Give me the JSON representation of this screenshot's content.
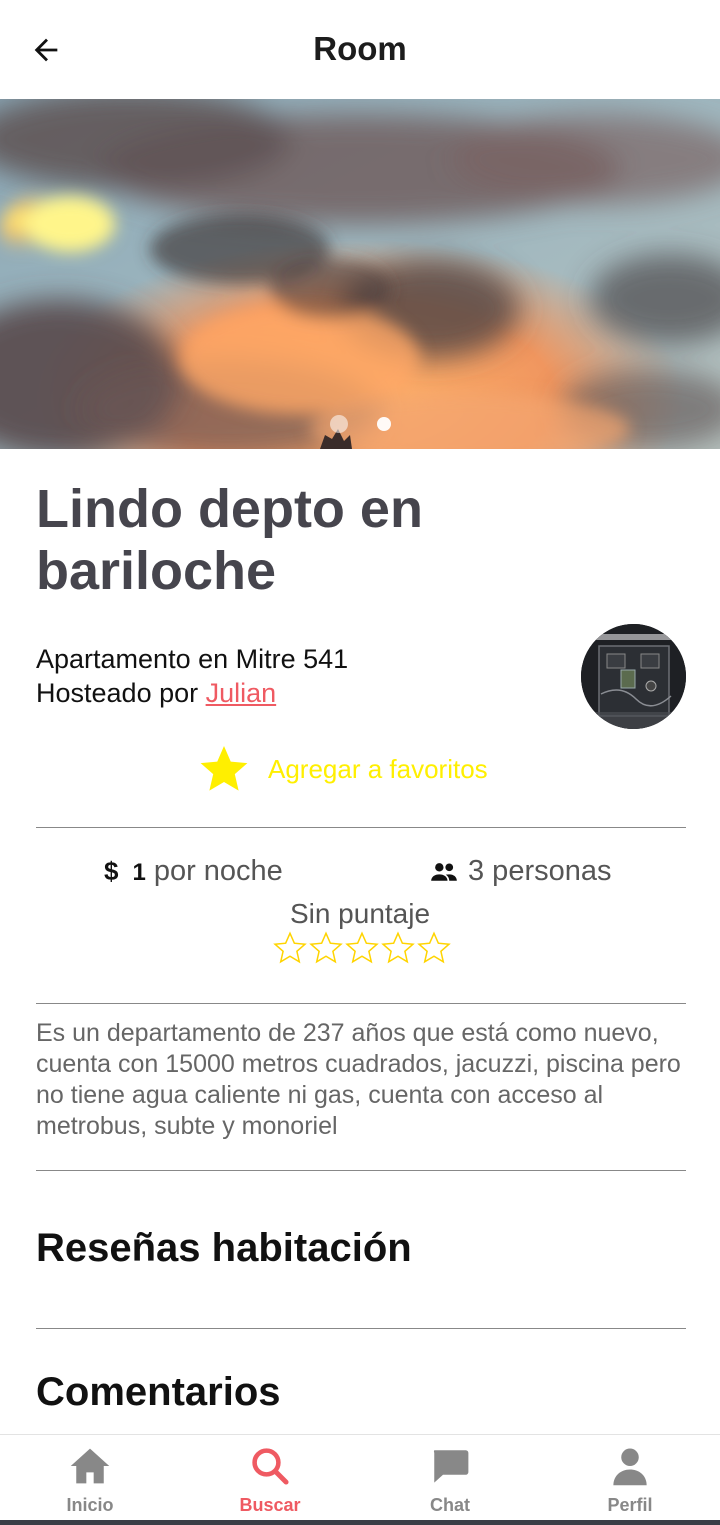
{
  "header": {
    "title": "Room",
    "back_icon": "arrow-left-icon"
  },
  "carousel": {
    "slides": 2,
    "active_index": 0
  },
  "listing": {
    "title": "Lindo depto en bariloche",
    "subtitle": "Apartamento en Mitre 541",
    "hosted_prefix": "Hosteado por ",
    "host_name": "Julian",
    "favorite_label": "Agregar a favoritos",
    "price_currency": "$",
    "price_value": "1",
    "price_suffix": "por noche",
    "guests_label": "3 personas",
    "rating_label": "Sin puntaje",
    "rating_value": 0,
    "rating_max": 5,
    "description": "Es un departamento de 237 años que está como nuevo, cuenta con 15000 metros cuadrados, jacuzzi, piscina pero no tiene agua caliente ni gas, cuenta con acceso al metrobus, subte y monoriel"
  },
  "sections": {
    "reviews": "Reseñas habitación",
    "comments": "Comentarios"
  },
  "nav": {
    "items": [
      {
        "label": "Inicio",
        "icon": "home-icon"
      },
      {
        "label": "Buscar",
        "icon": "search-icon"
      },
      {
        "label": "Chat",
        "icon": "chat-icon"
      },
      {
        "label": "Perfil",
        "icon": "user-icon"
      }
    ],
    "active": "Buscar"
  },
  "colors": {
    "accent": "#ef5a62",
    "favorite": "#ffef00",
    "title": "#46454d",
    "nav_inactive": "#888888"
  }
}
